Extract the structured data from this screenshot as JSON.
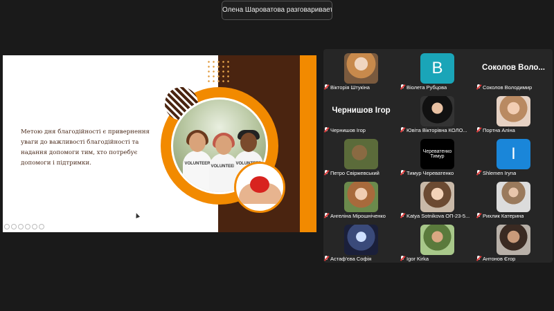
{
  "speaker_toast": "Олена Шароватова разговаривает...",
  "slide": {
    "text": "Метою дня благодійності є привернення уваги до важливості благодійності та надання допомоги тим, хто потребує допомоги і підтримки.",
    "volunteer_label": "VOLUNTEER",
    "colors": {
      "brown": "#4a2410",
      "orange": "#f28a00"
    }
  },
  "participants": [
    {
      "name": "Вікторія Штукіна",
      "avatar": "photo",
      "muted": true
    },
    {
      "name": "Віолета Рубцова",
      "avatar": "initial",
      "initial": "В",
      "color": "#1aa5b8",
      "muted": true
    },
    {
      "name": "Соколов Володимир",
      "avatar": "name",
      "big_name": "Соколов Воло...",
      "muted": true
    },
    {
      "name": "Чернишов Ігор",
      "avatar": "name",
      "big_name": "Чернишов Ігор",
      "muted": true
    },
    {
      "name": "Ювіта Вікторівна КОЛО...",
      "avatar": "photo",
      "muted": true
    },
    {
      "name": "Портна Аліна",
      "avatar": "photo",
      "muted": true
    },
    {
      "name": "Петро Свіржевський",
      "avatar": "photo",
      "muted": true
    },
    {
      "name": "Тимур Череватенко",
      "avatar": "text",
      "avatar_text": "Череватенко Тимур",
      "muted": true
    },
    {
      "name": "Shlemen Iryna",
      "avatar": "initial",
      "initial": "I",
      "color": "#1a86d9",
      "muted": true
    },
    {
      "name": "Ангеліна Мірошніченко",
      "avatar": "photo",
      "muted": true
    },
    {
      "name": "Katya Sotnikova ОП-23-5...",
      "avatar": "photo",
      "muted": true
    },
    {
      "name": "Рихлик Катерина",
      "avatar": "photo",
      "muted": true
    },
    {
      "name": "Астаф'єва Софія",
      "avatar": "photo",
      "muted": true
    },
    {
      "name": "Igor Kirka",
      "avatar": "photo",
      "muted": true
    },
    {
      "name": "Антонов Єгор",
      "avatar": "photo",
      "muted": true
    }
  ]
}
